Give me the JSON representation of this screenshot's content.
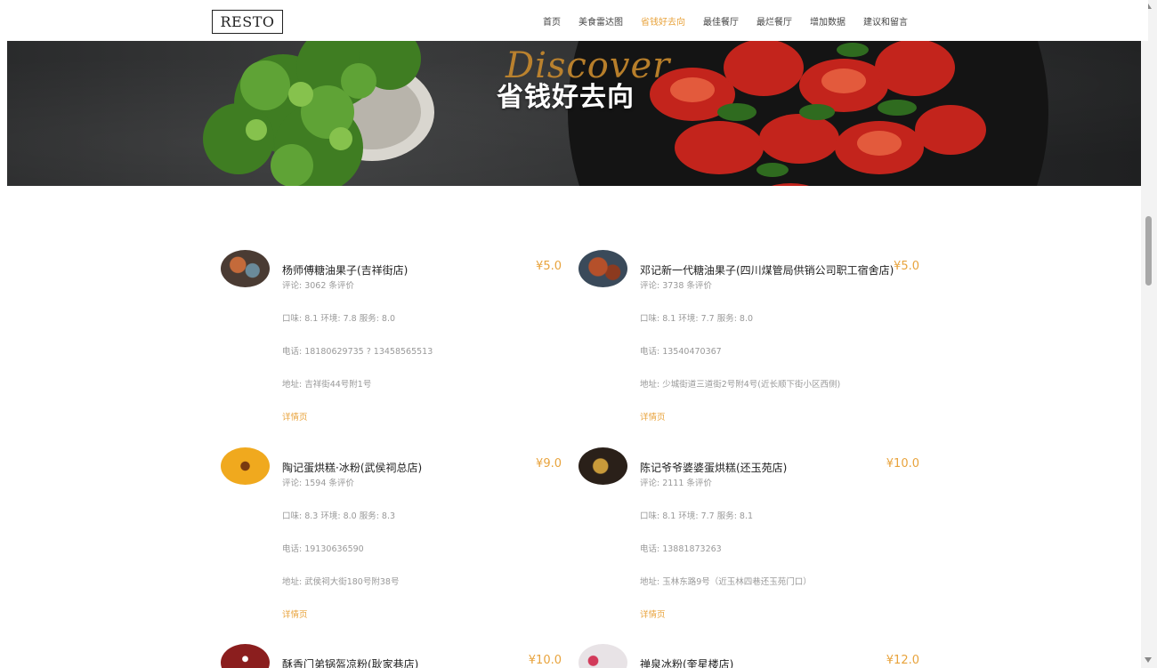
{
  "brand": "RESTO",
  "nav": [
    "首页",
    "美食雷达图",
    "省钱好去向",
    "最佳餐厅",
    "最烂餐厅",
    "增加数据",
    "建议和留言"
  ],
  "hero": {
    "script": "Discover",
    "title": "省钱好去向"
  },
  "restaurants": [
    {
      "name": "杨师傅糖油果子(吉祥街店)",
      "price": "¥5.0",
      "reviews": "评论: 3062 条评价",
      "scores": "口味: 8.1 环境: 7.8 服务: 8.0",
      "phone": "电话: 18180629735 ? 13458565513",
      "address": "地址: 吉祥街44号附1号",
      "detail": "详情页",
      "thumb_color": "#6b4a3a"
    },
    {
      "name": "邓记新一代糖油果子(四川煤管局供销公司职工宿舍店)",
      "price": "¥5.0",
      "reviews": "评论: 3738 条评价",
      "scores": "口味: 8.1 环境: 7.7 服务: 8.0",
      "phone": "电话: 13540470367",
      "address": "地址: 少城街道三道街2号附4号(近长顺下街小区西侧)",
      "detail": "详情页",
      "thumb_color": "#7a3b24"
    },
    {
      "name": "陶记蛋烘糕·冰粉(武侯祠总店)",
      "price": "¥9.0",
      "reviews": "评论: 1594 条评价",
      "scores": "口味: 8.3 环境: 8.0 服务: 8.3",
      "phone": "电话: 19130636590",
      "address": "地址: 武侯祠大街180号附38号",
      "detail": "详情页",
      "thumb_color": "#f0a91e"
    },
    {
      "name": "陈记爷爷婆婆蛋烘糕(还玉苑店)",
      "price": "¥10.0",
      "reviews": "评论: 2111 条评价",
      "scores": "口味: 8.1 环境: 7.7 服务: 8.1",
      "phone": "电话: 13881873263",
      "address": "地址: 玉林东路9号（近玉林四巷还玉苑门口）",
      "detail": "详情页",
      "thumb_color": "#3b2a1e"
    },
    {
      "name": "酥香门弟锅盔凉粉(耿家巷店)",
      "price": "¥10.0",
      "reviews": "",
      "scores": "",
      "phone": "",
      "address": "",
      "detail": "",
      "thumb_color": "#8b1e1e"
    },
    {
      "name": "禅泉冰粉(奎星楼店)",
      "price": "¥12.0",
      "reviews": "",
      "scores": "",
      "phone": "",
      "address": "",
      "detail": "",
      "thumb_color": "#e8e3e6"
    }
  ]
}
